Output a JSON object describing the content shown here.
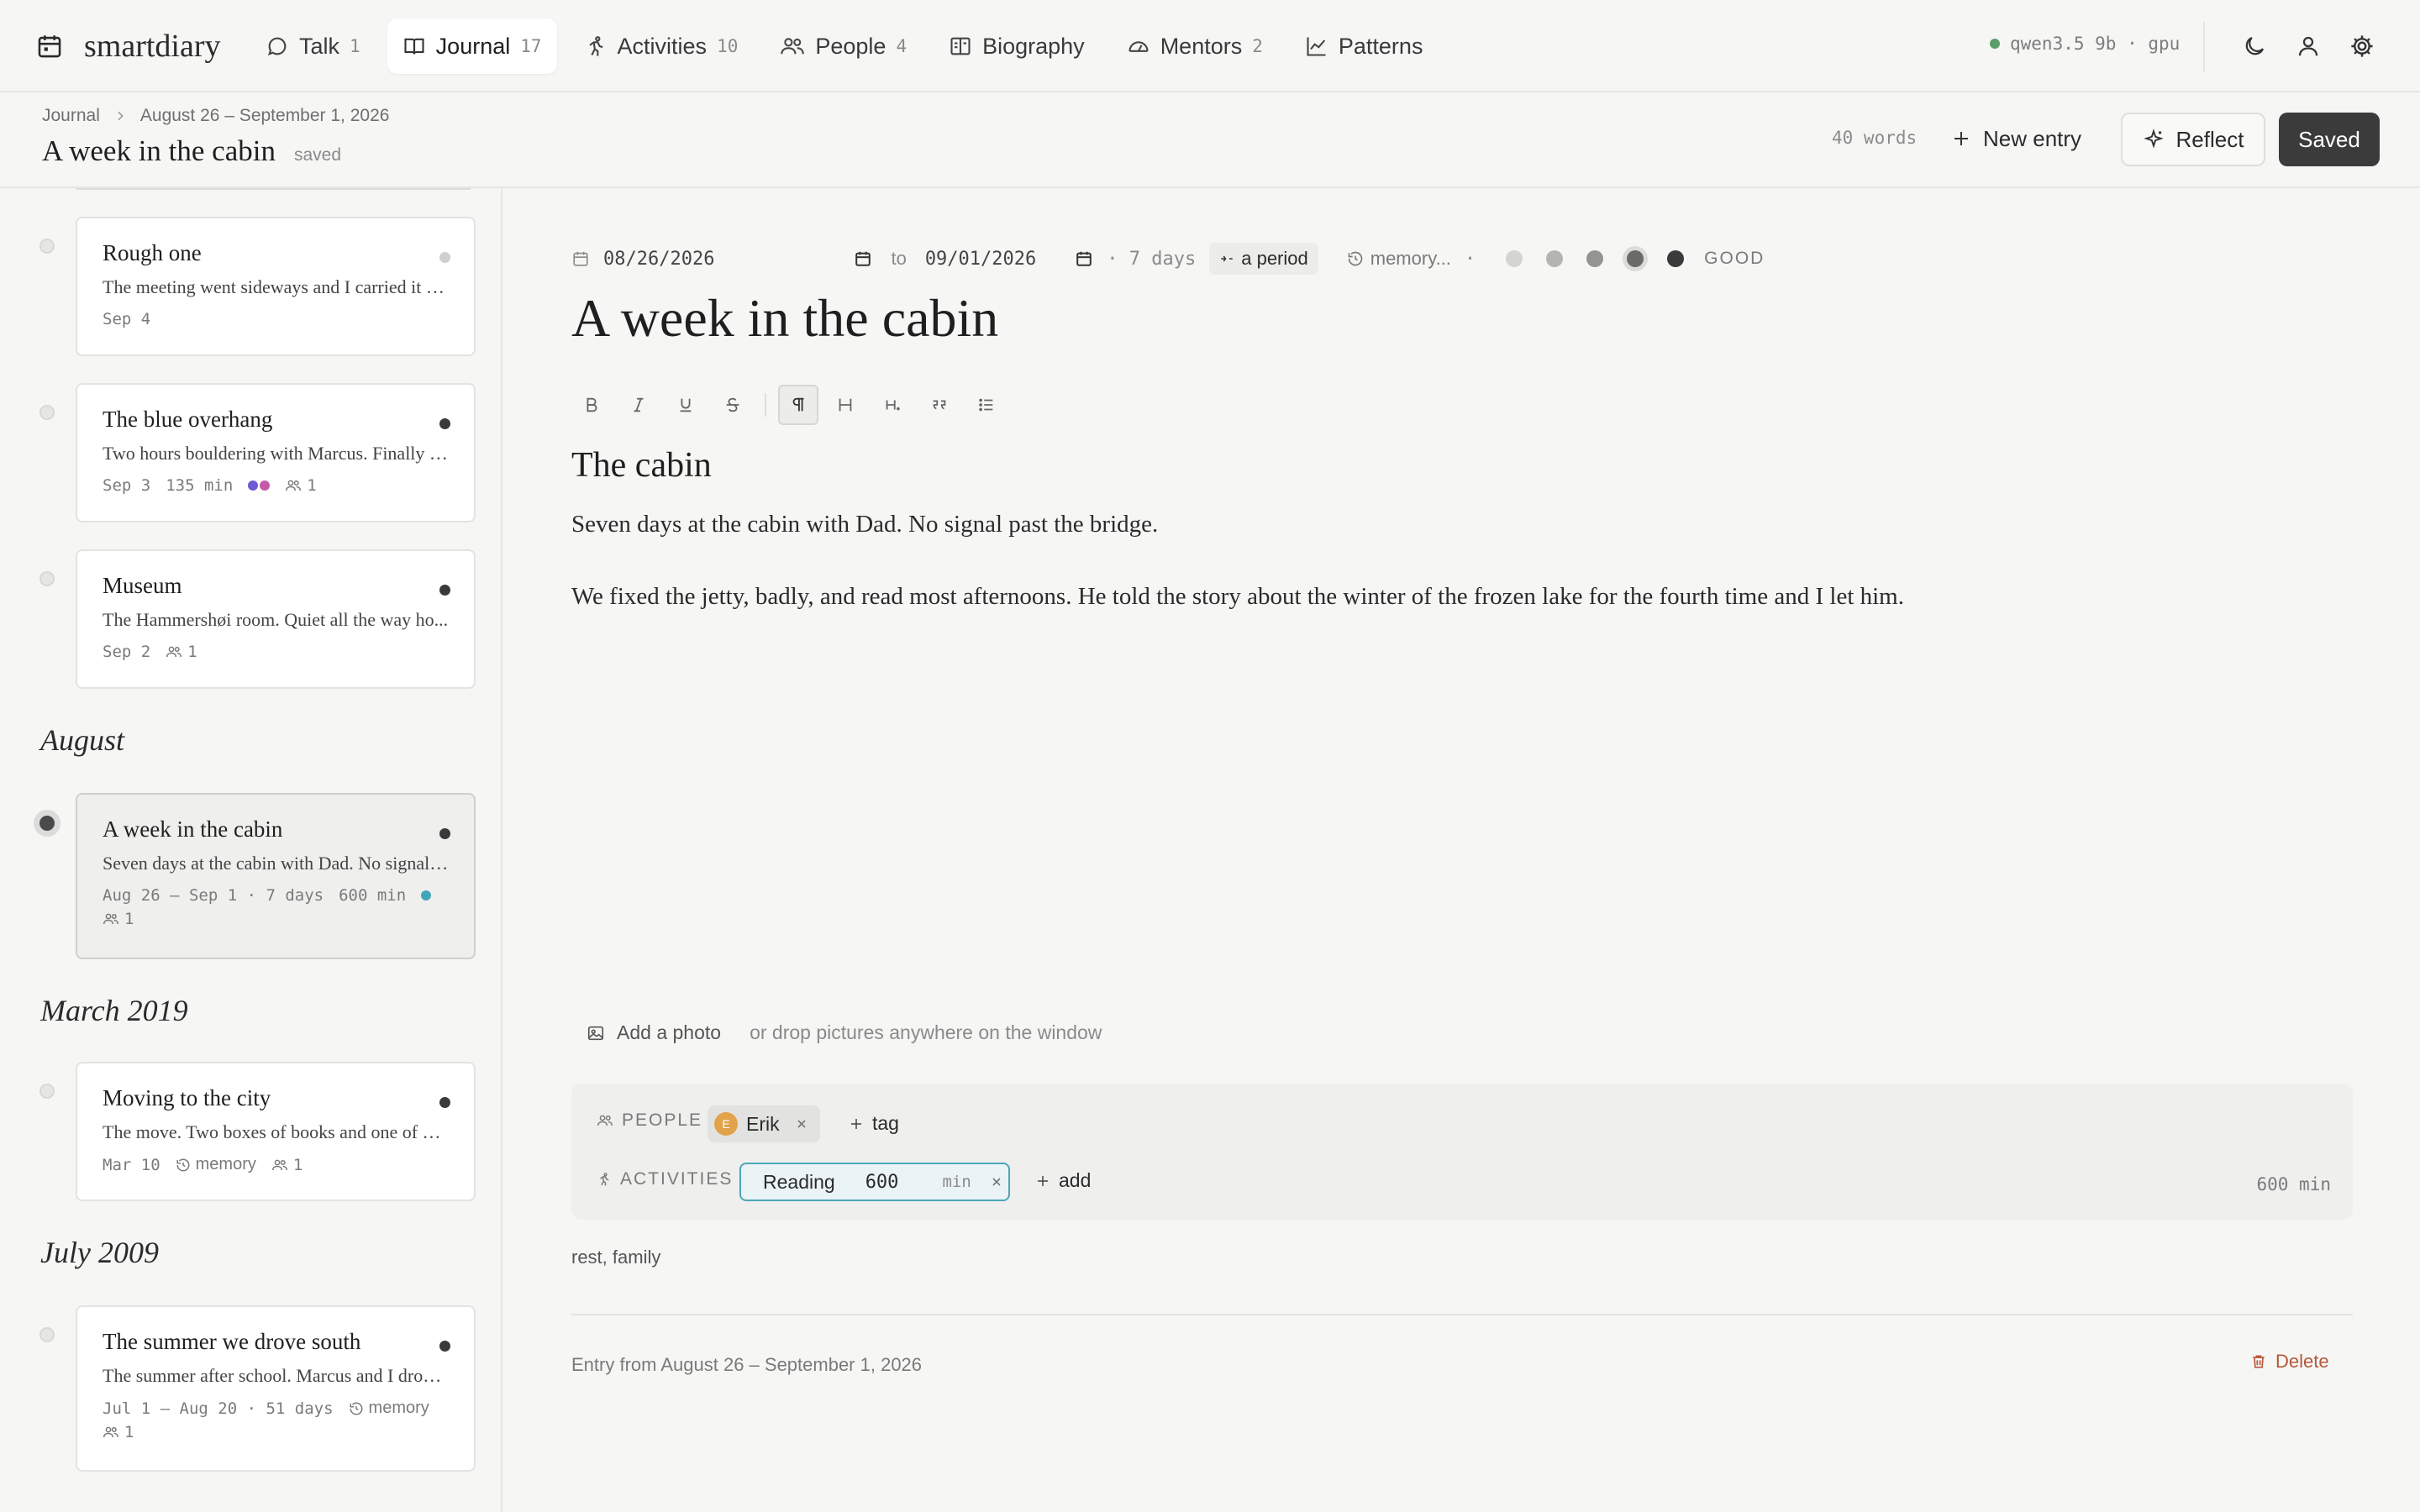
{
  "app": {
    "name": "smartdiary",
    "nav": [
      {
        "label": "Talk",
        "count": "1",
        "icon": "chat-bubble-icon"
      },
      {
        "label": "Journal",
        "count": "17",
        "icon": "book-icon",
        "active": true
      },
      {
        "label": "Activities",
        "count": "10",
        "icon": "running-person-icon"
      },
      {
        "label": "People",
        "count": "4",
        "icon": "people-icon"
      },
      {
        "label": "Biography",
        "count": "",
        "icon": "open-book-icon"
      },
      {
        "label": "Mentors",
        "count": "2",
        "icon": "gauge-icon"
      },
      {
        "label": "Patterns",
        "count": "",
        "icon": "line-chart-icon"
      }
    ],
    "model_status": "qwen3.5 9b · gpu",
    "status_color": "#5a9c6a"
  },
  "header": {
    "breadcrumb": [
      "Journal",
      "August 26 – September 1, 2026"
    ],
    "title": "A week in the cabin",
    "save_state": "saved",
    "word_count": "40 words",
    "new_entry_label": "New entry",
    "reflect_label": "Reflect",
    "saved_button_label": "Saved"
  },
  "sidebar": {
    "sections": [
      {
        "heading": "",
        "entries": [
          {
            "title": "Rough one",
            "excerpt": "The meeting went sideways and I carried it all...",
            "date": "Sep 4",
            "dot": "light"
          },
          {
            "title": "The blue overhang",
            "excerpt": "Two hours bouldering with Marcus. Finally g...",
            "date": "Sep 3",
            "duration": "135 min",
            "people": "1",
            "activity_colors": [
              "#6b5bd6",
              "#c45aa8"
            ]
          },
          {
            "title": "Museum",
            "excerpt": "The Hammershøi room. Quiet all the way ho...",
            "date": "Sep 2",
            "people": "1"
          }
        ]
      },
      {
        "heading": "August",
        "entries": [
          {
            "title": "A week in the cabin",
            "excerpt": "Seven days at the cabin with Dad. No signal p...",
            "date": "Aug 26 – Sep 1 · 7 days",
            "duration": "600 min",
            "people": "1",
            "activity_colors": [
              "#3fa7b8"
            ],
            "active": true
          }
        ]
      },
      {
        "heading": "March 2019",
        "entries": [
          {
            "title": "Moving to the city",
            "excerpt": "The move. Two boxes of books and one of ev...",
            "date": "Mar 10",
            "memory": "memory",
            "people": "1"
          }
        ]
      },
      {
        "heading": "July 2009",
        "entries": [
          {
            "title": "The summer we drove south",
            "excerpt": "The summer after school. Marcus and I drove...",
            "date": "Jul 1 – Aug 20 · 51 days",
            "memory": "memory",
            "people": "1"
          }
        ]
      }
    ]
  },
  "editor": {
    "start_date": "08/26/2026",
    "to_label": "to",
    "end_date": "09/01/2026",
    "days": "· 7 days",
    "period_label": "a period",
    "memory_label": "memory...",
    "mood_separator": "·",
    "mood_levels": 5,
    "mood_selected": 4,
    "mood_label": "GOOD",
    "title": "A week in the cabin",
    "toolbar": [
      "bold-icon",
      "italic-icon",
      "underline-icon",
      "strikethrough-icon",
      "paragraph-icon",
      "heading-icon",
      "heading-small-icon",
      "quote-icon",
      "list-icon"
    ],
    "heading": "The cabin",
    "paragraphs": [
      "Seven days at the cabin with Dad. No signal past the bridge.",
      "We fixed the jetty, badly, and read most afternoons. He told the story about the winter of the frozen lake for the fourth time and I let him."
    ],
    "add_photo_label": "Add a photo",
    "photo_hint": "or drop pictures anywhere on the window",
    "people_label": "PEOPLE",
    "person": {
      "name": "Erik",
      "initial": "E"
    },
    "tag_label": "tag",
    "activities_label": "ACTIVITIES",
    "activity": {
      "name": "Reading",
      "minutes": "600",
      "unit": "min",
      "color": "#3fa7b8"
    },
    "add_label": "add",
    "activity_total": "600 min",
    "keywords": "rest, family",
    "footer": "Entry from August 26 – September 1, 2026",
    "delete_label": "Delete"
  }
}
